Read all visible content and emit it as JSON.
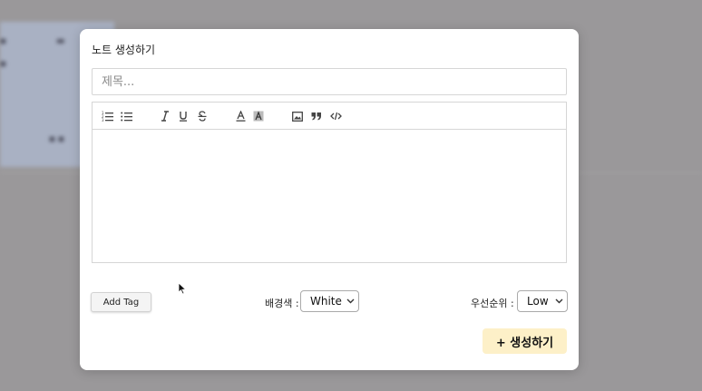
{
  "modal": {
    "title": "노트 생성하기",
    "title_input": {
      "placeholder": "제목...",
      "value": ""
    },
    "toolbar": {
      "items": [
        "ordered-list-icon",
        "bullet-list-icon",
        "italic-icon",
        "underline-icon",
        "strikethrough-icon",
        "font-color-icon",
        "background-color-icon",
        "image-icon",
        "quote-icon",
        "code-icon"
      ]
    },
    "add_tag_label": "Add Tag",
    "background_label": "배경색 :",
    "background_value": "White",
    "priority_label": "우선순위 :",
    "priority_value": "Low",
    "create_label": "+ 생성하기"
  },
  "colors": {
    "overlay": "#9a989a",
    "modal_bg": "#ffffff",
    "create_button_bg": "#fdf0c8"
  }
}
